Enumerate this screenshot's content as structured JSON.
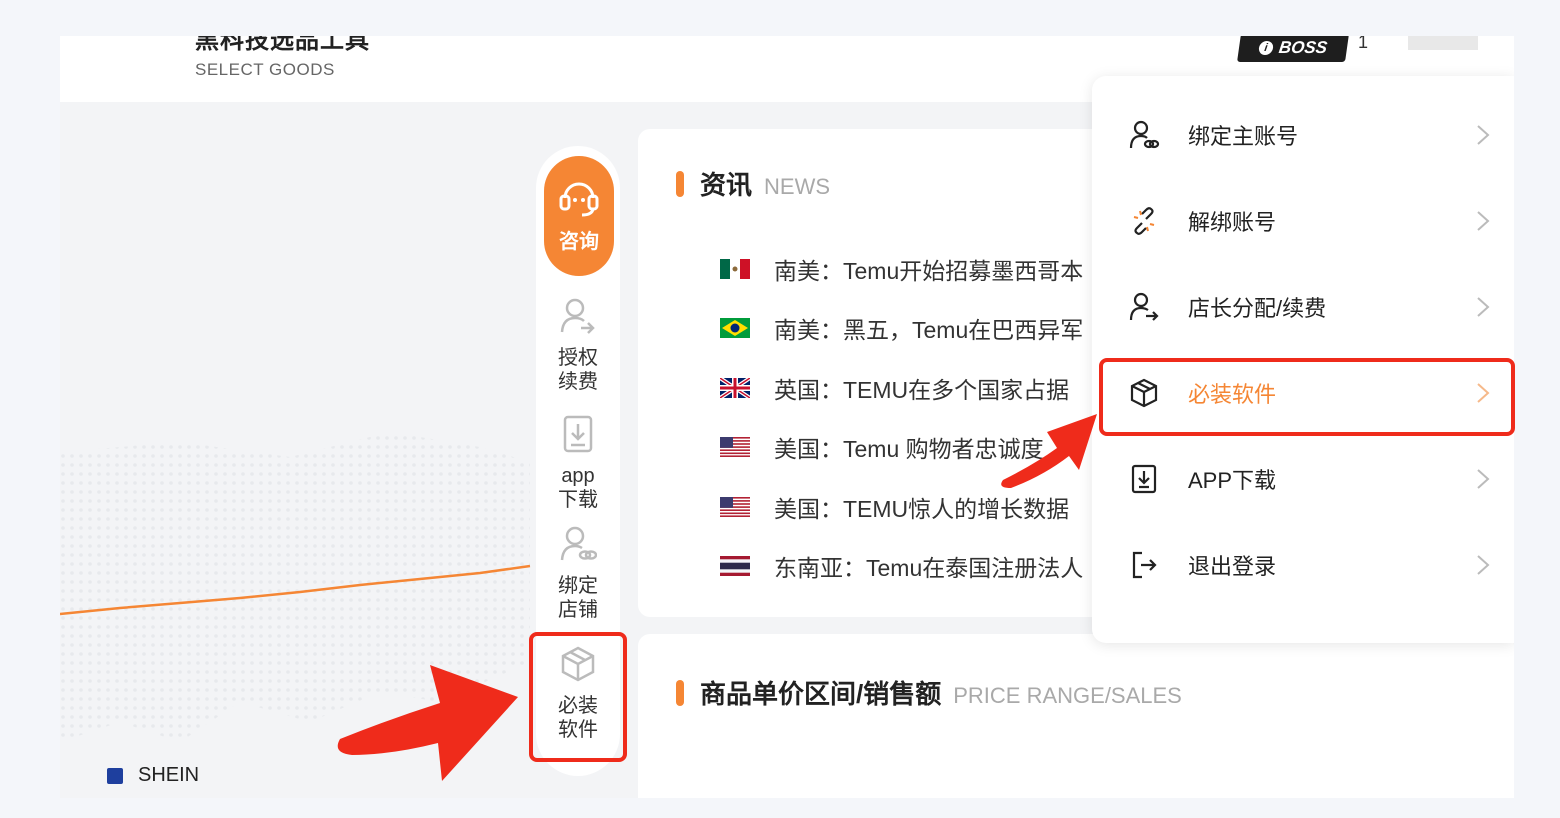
{
  "header": {
    "title": "黑科技选品工具",
    "subtitle": "SELECT GOODS",
    "badge_label": "BOSS",
    "account_text": "1"
  },
  "chart": {
    "legend": "SHEIN",
    "colors": {
      "line": "#f58634",
      "legend": "#1e3f9e"
    }
  },
  "sidebar": {
    "consult_label": "咨询",
    "items": [
      {
        "label_line1": "授权",
        "label_line2": "续费",
        "icon": "user-renew-icon"
      },
      {
        "label_line1": "app",
        "label_line2": "下载",
        "icon": "download-icon"
      },
      {
        "label_line1": "绑定",
        "label_line2": "店铺",
        "icon": "bind-store-icon"
      },
      {
        "label_line1": "必装",
        "label_line2": "软件",
        "icon": "box-icon"
      }
    ]
  },
  "news": {
    "title_cn": "资讯",
    "title_en": "NEWS",
    "items": [
      {
        "flag": "mexico",
        "text": "南美：Temu开始招募墨西哥本"
      },
      {
        "flag": "brazil",
        "text": "南美：黑五，Temu在巴西异军"
      },
      {
        "flag": "uk",
        "text": "英国：TEMU在多个国家占据"
      },
      {
        "flag": "usa",
        "text": "美国：Temu 购物者忠诚度"
      },
      {
        "flag": "usa",
        "text": "美国：TEMU惊人的增长数据"
      },
      {
        "flag": "thailand",
        "text": "东南亚：Temu在泰国注册法人"
      }
    ]
  },
  "price_section": {
    "title_cn": "商品单价区间/销售额",
    "title_en": "PRICE RANGE/SALES"
  },
  "menu": {
    "items": [
      {
        "label": "绑定主账号",
        "icon": "bind-account-icon"
      },
      {
        "label": "解绑账号",
        "icon": "unlink-icon"
      },
      {
        "label": "店长分配/续费",
        "icon": "user-assign-icon"
      },
      {
        "label": "必装软件",
        "icon": "box-icon",
        "active": true
      },
      {
        "label": "APP下载",
        "icon": "download-icon"
      },
      {
        "label": "退出登录",
        "icon": "logout-icon"
      }
    ],
    "active_color": "#f58634"
  },
  "annotation_color": "#ef2b1b"
}
